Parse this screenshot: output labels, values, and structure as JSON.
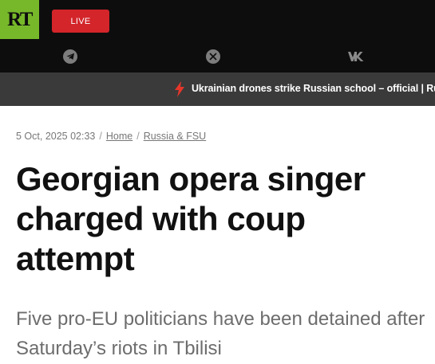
{
  "header": {
    "logo_text": "RT",
    "live_label": "LIVE",
    "social_icons": [
      "telegram-icon",
      "x-icon",
      "vk-icon"
    ]
  },
  "ticker": {
    "text": "Ukrainian drones strike Russian school – official | Ru"
  },
  "article": {
    "date": "5 Oct, 2025 02:33",
    "breadcrumbs": [
      "Home",
      "Russia & FSU"
    ],
    "title": "Georgian opera singer charged with coup attempt",
    "summary": "Five pro-EU politicians have been detained after Saturday’s riots in Tbilisi"
  },
  "colors": {
    "logo_green": "#77b82a",
    "live_red": "#d3252a",
    "ticker_bolt": "#e5362a",
    "header_bg": "#0d0d0d",
    "ticker_bg": "#3a3a3a"
  }
}
